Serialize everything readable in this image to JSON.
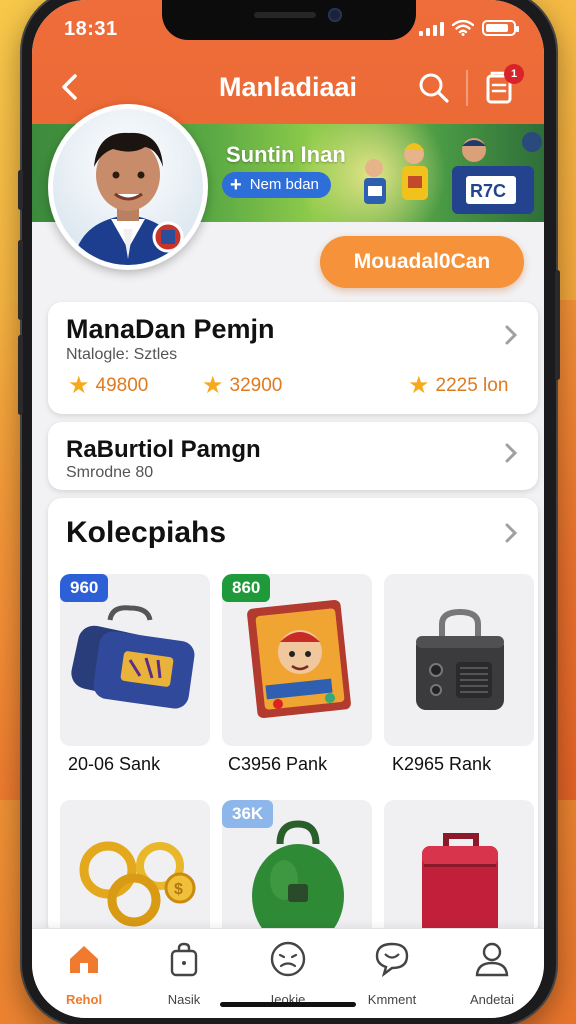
{
  "status": {
    "time": "18:31",
    "battery_level": 0.85
  },
  "topbar": {
    "title": "Manladiaai",
    "cart_badge": "1"
  },
  "banner": {
    "title": "Suntin Inan",
    "button_label": "Nem bdan"
  },
  "profile": {
    "follow_label": "Mouadal0Can"
  },
  "card_profile": {
    "title": "ManaDan Pemjn",
    "subtitle": "Ntalogle: Sztles",
    "stats": [
      "49800",
      "32900",
      "2225 lon"
    ]
  },
  "card_second": {
    "title": "RaBurtiol Pamgn",
    "subtitle": "Smrodne 80"
  },
  "card_collection": {
    "title": "Kolecpiahs",
    "items": [
      {
        "tag": "960",
        "tag_color": "#2d5fd6",
        "label": "20-06 Sank"
      },
      {
        "tag": "860",
        "tag_color": "#1f9a3a",
        "label": "C3956 Pank"
      },
      {
        "tag": "",
        "tag_color": "",
        "label": "K2965 Rank"
      },
      {
        "tag": "",
        "tag_color": "",
        "label": ""
      },
      {
        "tag": "36K",
        "tag_color": "#8db6ea",
        "label": ""
      },
      {
        "tag": "",
        "tag_color": "",
        "label": ""
      }
    ]
  },
  "tabbar": {
    "items": [
      {
        "label": "Rehol",
        "icon": "home-icon"
      },
      {
        "label": "Nasik",
        "icon": "bag-icon"
      },
      {
        "label": "Ieokie",
        "icon": "face-icon"
      },
      {
        "label": "Kmment",
        "icon": "chat-icon"
      },
      {
        "label": "Andetai",
        "icon": "person-icon"
      }
    ]
  },
  "colors": {
    "accent": "#ef6d3a",
    "button": "#f5923a",
    "star": "#f6a91c"
  }
}
